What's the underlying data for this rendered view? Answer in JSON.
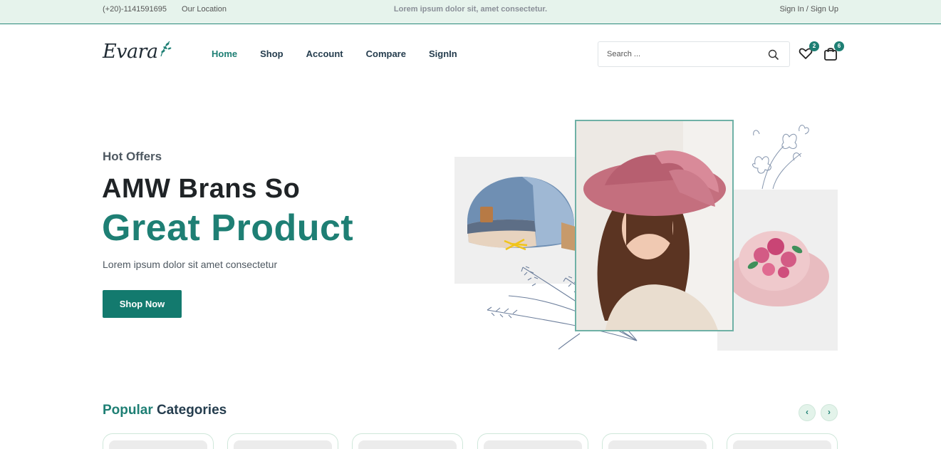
{
  "topbar": {
    "phone": "(+20)-1141591695",
    "location": "Our Location",
    "promo": "Lorem ipsum dolor sit, amet consectetur.",
    "auth": "Sign In / Sign Up"
  },
  "header": {
    "logo_text": "Evara",
    "nav": [
      "Home",
      "Shop",
      "Account",
      "Compare",
      "SignIn"
    ],
    "active_nav": "Home",
    "search_placeholder": "Search ...",
    "wishlist_count": "2",
    "cart_count": "6"
  },
  "hero": {
    "subtitle": "Hot Offers",
    "title_line1": "AMW Brans So",
    "title_line2": "Great Product",
    "description": "Lorem ipsum dolor sit amet consectetur",
    "button": "Shop Now"
  },
  "categories": {
    "title_accent": "Popular",
    "title_rest": " Categories",
    "prev_label": "‹",
    "next_label": "›"
  },
  "colors": {
    "brand": "#1e7f74",
    "topbar_bg": "#e6f3ec",
    "text_dark": "#253d4e"
  }
}
